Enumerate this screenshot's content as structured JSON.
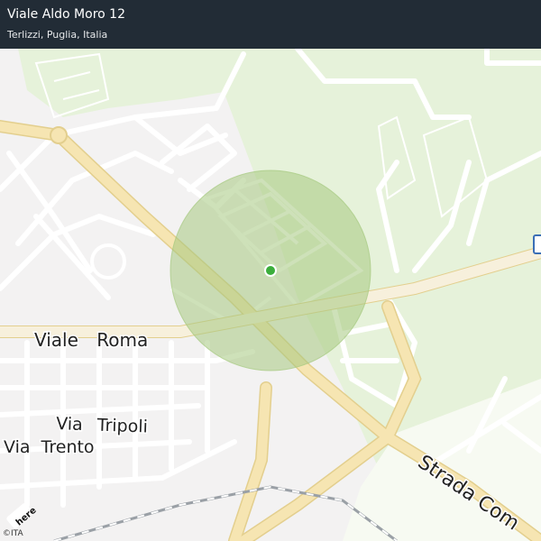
{
  "header": {
    "title": "Viale Aldo Moro 12",
    "subtitle": "Terlizzi, Puglia, Italia"
  },
  "map": {
    "streets": [
      {
        "id": "viale-roma",
        "name": "Viale Roma"
      },
      {
        "id": "via-tripoli",
        "name": "Via Tripoli"
      },
      {
        "id": "via-trento",
        "name": "Via Trento"
      },
      {
        "id": "strada-com",
        "name": "Strada Com"
      }
    ],
    "accuracy_circle_color": "#a5c97f",
    "location_dot_color": "#3cae3c",
    "park_color": "#e6f2da",
    "major_road_color": "#f6e5b2"
  },
  "attribution": {
    "logo": "here",
    "copyright": "©ITA"
  }
}
